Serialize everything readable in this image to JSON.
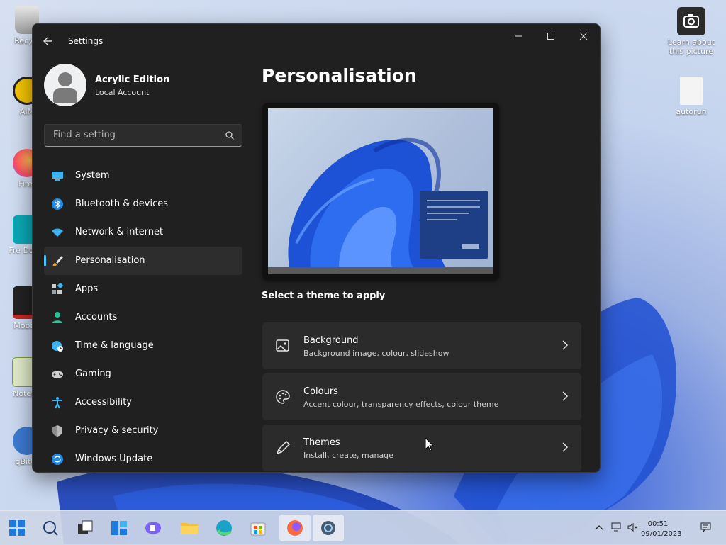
{
  "desktop": {
    "icons": [
      {
        "label": "Recycl",
        "icon": "recycle-bin-icon"
      },
      {
        "label": "AIM",
        "icon": "aimp-icon"
      },
      {
        "label": "Firef",
        "icon": "firefox-icon"
      },
      {
        "label": "Fre Down",
        "icon": "free-download-manager-icon"
      },
      {
        "label": "MobaX",
        "icon": "mobaxterm-icon"
      },
      {
        "label": "Notepa",
        "icon": "notepad-icon"
      },
      {
        "label": "qBitto",
        "icon": "qbittorrent-icon"
      },
      {
        "label": "Learn about this picture",
        "icon": "camera-icon"
      },
      {
        "label": "autorun",
        "icon": "autorun-file-icon"
      }
    ]
  },
  "window": {
    "title": "Settings",
    "controls": {
      "minimize": "—",
      "maximize": "☐",
      "close": "✕"
    }
  },
  "profile": {
    "name": "Acrylic Edition",
    "account_type": "Local Account"
  },
  "search": {
    "placeholder": "Find a setting"
  },
  "nav": {
    "items": [
      {
        "label": "System",
        "icon": "system-icon"
      },
      {
        "label": "Bluetooth & devices",
        "icon": "bluetooth-icon"
      },
      {
        "label": "Network & internet",
        "icon": "wifi-icon"
      },
      {
        "label": "Personalisation",
        "icon": "brush-icon",
        "active": true
      },
      {
        "label": "Apps",
        "icon": "apps-icon"
      },
      {
        "label": "Accounts",
        "icon": "accounts-icon"
      },
      {
        "label": "Time & language",
        "icon": "globe-clock-icon"
      },
      {
        "label": "Gaming",
        "icon": "gamepad-icon"
      },
      {
        "label": "Accessibility",
        "icon": "accessibility-icon"
      },
      {
        "label": "Privacy & security",
        "icon": "shield-icon"
      },
      {
        "label": "Windows Update",
        "icon": "update-icon"
      }
    ]
  },
  "main": {
    "title": "Personalisation",
    "theme_caption": "Select a theme to apply",
    "cards": [
      {
        "title": "Background",
        "subtitle": "Background image, colour, slideshow",
        "icon": "image-icon"
      },
      {
        "title": "Colours",
        "subtitle": "Accent colour, transparency effects, colour theme",
        "icon": "palette-icon"
      },
      {
        "title": "Themes",
        "subtitle": "Install, create, manage",
        "icon": "pen-icon"
      }
    ]
  },
  "taskbar": {
    "items": [
      "start-icon",
      "search-icon",
      "task-view-icon",
      "widgets-icon",
      "chat-icon",
      "file-explorer-icon",
      "edge-icon",
      "store-icon",
      "firefox-icon",
      "settings-icon"
    ],
    "active": [
      "firefox-icon",
      "settings-icon"
    ],
    "time": "00:51",
    "date": "09/01/2023"
  },
  "colors": {
    "accent": "#4cc2ff",
    "window_bg": "#202020",
    "card_bg": "#2b2b2b"
  }
}
